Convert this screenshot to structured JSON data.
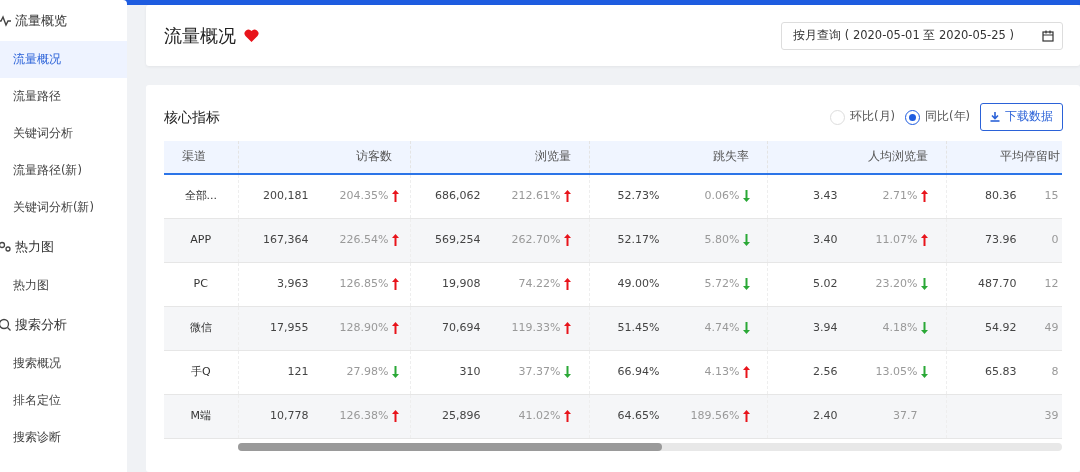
{
  "sidebar": {
    "groups": [
      {
        "label": "流量概览",
        "items": [
          {
            "label": "流量概况",
            "selected": true
          },
          {
            "label": "流量路径",
            "selected": false
          },
          {
            "label": "关键词分析",
            "selected": false
          },
          {
            "label": "流量路径(新)",
            "selected": false
          },
          {
            "label": "关键词分析(新)",
            "selected": false
          }
        ]
      },
      {
        "label": "热力图",
        "items": [
          {
            "label": "热力图",
            "selected": false
          }
        ]
      },
      {
        "label": "搜索分析",
        "items": [
          {
            "label": "搜索概况",
            "selected": false
          },
          {
            "label": "排名定位",
            "selected": false
          },
          {
            "label": "搜索诊断",
            "selected": false
          }
        ]
      }
    ]
  },
  "header": {
    "title": "流量概况",
    "date_filter": "按月查询 ( 2020-05-01 至 2020-05-25 )"
  },
  "panel": {
    "title": "核心指标",
    "compare_options": [
      {
        "label": "环比(月)",
        "selected": false
      },
      {
        "label": "同比(年)",
        "selected": true
      }
    ],
    "download_button": "下载数据"
  },
  "table": {
    "columns": [
      "渠道",
      "访客数",
      "浏览量",
      "跳失率",
      "人均浏览量",
      "平均停留时"
    ],
    "rows": [
      {
        "cells": [
          {
            "value": "全部..."
          },
          {
            "value": "200,181",
            "change": "204.35%",
            "rising": true
          },
          {
            "value": "686,062",
            "change": "212.61%",
            "rising": true
          },
          {
            "value": "52.73%",
            "change": "0.06%",
            "rising": false
          },
          {
            "value": "3.43",
            "change": "2.71%",
            "rising": true
          },
          {
            "value": "80.36",
            "change": "15"
          }
        ]
      },
      {
        "cells": [
          {
            "value": "APP"
          },
          {
            "value": "167,364",
            "change": "226.54%",
            "rising": true
          },
          {
            "value": "569,254",
            "change": "262.70%",
            "rising": true
          },
          {
            "value": "52.17%",
            "change": "5.80%",
            "rising": false
          },
          {
            "value": "3.40",
            "change": "11.07%",
            "rising": true
          },
          {
            "value": "73.96",
            "change": "0"
          }
        ]
      },
      {
        "cells": [
          {
            "value": "PC"
          },
          {
            "value": "3,963",
            "change": "126.85%",
            "rising": true
          },
          {
            "value": "19,908",
            "change": "74.22%",
            "rising": true
          },
          {
            "value": "49.00%",
            "change": "5.72%",
            "rising": false
          },
          {
            "value": "5.02",
            "change": "23.20%",
            "rising": false
          },
          {
            "value": "487.70",
            "change": "12"
          }
        ]
      },
      {
        "cells": [
          {
            "value": "微信"
          },
          {
            "value": "17,955",
            "change": "128.90%",
            "rising": true
          },
          {
            "value": "70,694",
            "change": "119.33%",
            "rising": true
          },
          {
            "value": "51.45%",
            "change": "4.74%",
            "rising": false
          },
          {
            "value": "3.94",
            "change": "4.18%",
            "rising": false
          },
          {
            "value": "54.92",
            "change": "49"
          }
        ]
      },
      {
        "cells": [
          {
            "value": "手Q"
          },
          {
            "value": "121",
            "change": "27.98%",
            "rising": false
          },
          {
            "value": "310",
            "change": "37.37%",
            "rising": false
          },
          {
            "value": "66.94%",
            "change": "4.13%",
            "rising": true
          },
          {
            "value": "2.56",
            "change": "13.05%",
            "rising": false
          },
          {
            "value": "65.83",
            "change": "8"
          }
        ]
      },
      {
        "cells": [
          {
            "value": "M端"
          },
          {
            "value": "10,778",
            "change": "126.38%",
            "rising": true
          },
          {
            "value": "25,896",
            "change": "41.02%",
            "rising": true
          },
          {
            "value": "64.65%",
            "change": "189.56%",
            "rising": true
          },
          {
            "value": "2.40",
            "change": "37.7"
          },
          {
            "change": "39"
          }
        ]
      }
    ]
  }
}
